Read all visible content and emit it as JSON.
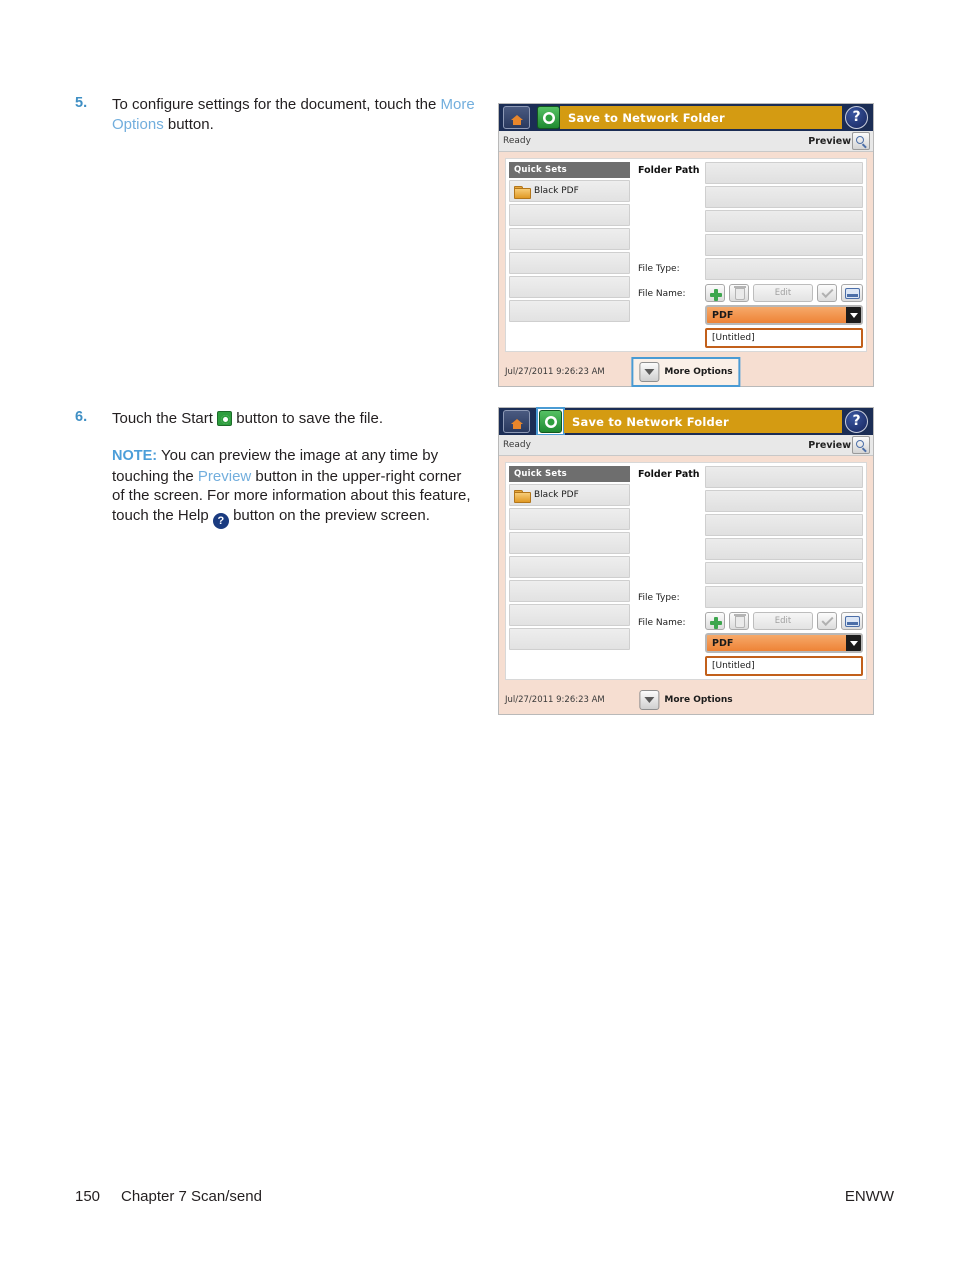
{
  "page": {
    "number": "150",
    "chapter": "Chapter 7   Scan/send",
    "imprint": "ENWW"
  },
  "steps": [
    {
      "number": "5.",
      "text_before": "To configure settings for the document, touch the ",
      "link": "More Options",
      "text_after": " button."
    },
    {
      "number": "6.",
      "text_before": "Touch the Start ",
      "icon": "start-icon",
      "text_after": " button to save the file."
    }
  ],
  "note": {
    "label": "NOTE:",
    "part1": "You can preview the image at any time by touching the ",
    "link": "Preview",
    "part2": " button in the upper-right corner of the screen. For more information about this feature, touch the Help ",
    "icon": "help-icon",
    "part3": " button on the preview screen."
  },
  "device_screen": {
    "titlebar": {
      "home_icon": "home-icon",
      "start_icon": "start-icon",
      "title": "Save to Network Folder",
      "help_icon": "help-icon",
      "help_glyph": "?"
    },
    "statusbar": {
      "status": "Ready",
      "preview_label": "Preview",
      "preview_icon": "magnifier-icon"
    },
    "quick_sets": {
      "header": "Quick Sets",
      "items": [
        {
          "label": "Black PDF",
          "icon": "folder-icon"
        },
        {
          "label": "",
          "icon": ""
        },
        {
          "label": "",
          "icon": ""
        },
        {
          "label": "",
          "icon": ""
        },
        {
          "label": "",
          "icon": ""
        },
        {
          "label": "",
          "icon": ""
        },
        {
          "label": "",
          "icon": ""
        }
      ]
    },
    "folder_path": {
      "title": "Folder Path",
      "rows": [
        "",
        "",
        "",
        "",
        ""
      ],
      "toolbar": {
        "add_icon": "plus-icon",
        "delete_icon": "trash-icon",
        "edit_label": "Edit",
        "ok_icon": "checkmark-icon",
        "keyboard_icon": "keyboard-icon"
      }
    },
    "file_type": {
      "label": "File Type:",
      "value": "PDF",
      "dropdown_icon": "chevron-down-icon"
    },
    "file_name": {
      "label": "File Name:",
      "value": "[Untitled]"
    },
    "footer": {
      "timestamp": "Jul/27/2011 9:26:23 AM",
      "more_options_label": "More Options",
      "more_options_icon": "chevron-down-icon"
    }
  },
  "colors": {
    "titlebar_navy": "#1b2d55",
    "title_gold": "#d49b12",
    "accent_orange": "#ee8336",
    "highlight_blue": "#4a9bd4",
    "link_blue": "#72aedd",
    "note_blue": "#4c9ed9",
    "step_blue": "#3f8fc4",
    "panel_peach": "#f6ded1"
  }
}
